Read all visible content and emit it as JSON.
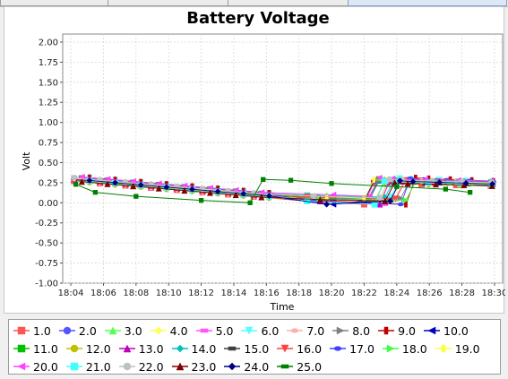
{
  "chart_data": {
    "type": "line",
    "title": "Battery Voltage",
    "xlabel": "Time",
    "ylabel": "Volt",
    "ylim": [
      -1.0,
      2.1
    ],
    "xlim_minutes": [
      1083.5,
      1110.5
    ],
    "x_ticks": [
      "18:04",
      "18:06",
      "18:08",
      "18:10",
      "18:12",
      "18:14",
      "18:16",
      "18:18",
      "18:20",
      "18:22",
      "18:24",
      "18:26",
      "18:28",
      "18:30"
    ],
    "y_ticks": [
      "2.00",
      "1.75",
      "1.50",
      "1.25",
      "1.00",
      "0.75",
      "0.50",
      "0.25",
      "0.00",
      "-0.25",
      "-0.50",
      "-0.75",
      "-1.00"
    ],
    "grid": true,
    "legend_position": "bottom",
    "series": [
      {
        "name": "1.0",
        "color": "#ff5555",
        "marker": "square"
      },
      {
        "name": "2.0",
        "color": "#5555ff",
        "marker": "circle"
      },
      {
        "name": "3.0",
        "color": "#55ff55",
        "marker": "triangle-up"
      },
      {
        "name": "4.0",
        "color": "#ffff55",
        "marker": "diamond"
      },
      {
        "name": "5.0",
        "color": "#ff55ff",
        "marker": "rect-h"
      },
      {
        "name": "6.0",
        "color": "#55ffff",
        "marker": "triangle-down"
      },
      {
        "name": "7.0",
        "color": "#ffafaf",
        "marker": "ellipse-h"
      },
      {
        "name": "8.0",
        "color": "#808080",
        "marker": "triangle-right"
      },
      {
        "name": "9.0",
        "color": "#c00000",
        "marker": "rect-v"
      },
      {
        "name": "10.0",
        "color": "#0000c0",
        "marker": "triangle-left"
      },
      {
        "name": "11.0",
        "color": "#00c000",
        "marker": "square"
      },
      {
        "name": "12.0",
        "color": "#c0c000",
        "marker": "circle"
      },
      {
        "name": "13.0",
        "color": "#c000c0",
        "marker": "triangle-up"
      },
      {
        "name": "14.0",
        "color": "#00c0c0",
        "marker": "diamond"
      },
      {
        "name": "15.0",
        "color": "#404040",
        "marker": "rect-h"
      },
      {
        "name": "16.0",
        "color": "#ff4040",
        "marker": "triangle-down"
      },
      {
        "name": "17.0",
        "color": "#4040ff",
        "marker": "ellipse-h"
      },
      {
        "name": "18.0",
        "color": "#40ff40",
        "marker": "triangle-right"
      },
      {
        "name": "19.0",
        "color": "#ffff40",
        "marker": "rect-v"
      },
      {
        "name": "20.0",
        "color": "#ff40ff",
        "marker": "triangle-left"
      },
      {
        "name": "21.0",
        "color": "#40ffff",
        "marker": "square"
      },
      {
        "name": "22.0",
        "color": "#c0c0c0",
        "marker": "circle"
      },
      {
        "name": "23.0",
        "color": "#800000",
        "marker": "triangle-up"
      },
      {
        "name": "24.0",
        "color": "#000080",
        "marker": "diamond"
      },
      {
        "name": "25.0",
        "color": "#008000",
        "marker": "rect-h"
      }
    ],
    "segments": {
      "early": {
        "x_start_minutes": 1084.2,
        "x_end_minutes": 1096.8,
        "y_start": 0.3,
        "y_end": 0.08
      },
      "late": {
        "x_start_minutes": 1098.5,
        "x_end_minutes": 1110.2,
        "y_start": 0.06,
        "y_end": 0.25
      },
      "late_low": {
        "x_start_minutes": 1100.0,
        "x_end_minutes": 1105.5,
        "y_values": [
          0.02,
          -0.02
        ]
      },
      "late_high": {
        "x_start_minutes": 1100.5,
        "x_end_minutes": 1110.0,
        "y_values": [
          0.3,
          0.26
        ]
      }
    },
    "green_series_25": {
      "x_minutes": [
        1084.3,
        1085.5,
        1088.0,
        1092.0,
        1095.0,
        1095.8,
        1097.5,
        1100.0,
        1104.0,
        1107.0,
        1108.5
      ],
      "y": [
        0.23,
        0.13,
        0.08,
        0.03,
        0.0,
        0.29,
        0.28,
        0.24,
        0.2,
        0.17,
        0.13
      ]
    }
  }
}
